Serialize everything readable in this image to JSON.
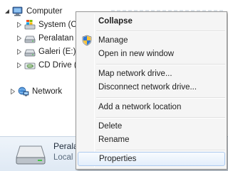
{
  "tree": {
    "items": [
      {
        "label": "Computer",
        "icon": "computer-icon",
        "expanded": true
      },
      {
        "label": "System (C:)",
        "icon": "windows-drive-icon"
      },
      {
        "label": "Peralatan (D:)",
        "icon": "hard-drive-icon"
      },
      {
        "label": "Galeri (E:)",
        "icon": "hard-drive-icon"
      },
      {
        "label": "CD Drive (H",
        "icon": "cd-drive-icon"
      },
      {
        "label": "Network",
        "icon": "network-icon"
      }
    ]
  },
  "details": {
    "name": "Perala",
    "type": "Local D"
  },
  "menu": {
    "items": [
      {
        "label": "Collapse",
        "bold": true
      },
      {
        "label": "Manage",
        "icon": "uac-shield-icon"
      },
      {
        "label": "Open in new window"
      },
      {
        "label": "Map network drive..."
      },
      {
        "label": "Disconnect network drive..."
      },
      {
        "label": "Add a network location"
      },
      {
        "label": "Delete"
      },
      {
        "label": "Rename"
      },
      {
        "label": "Properties",
        "highlighted": true
      }
    ]
  },
  "colors": {
    "highlight_border": "#aecbf0",
    "menu_background": "#f5f5f5",
    "details_background": "#e4edf6"
  }
}
